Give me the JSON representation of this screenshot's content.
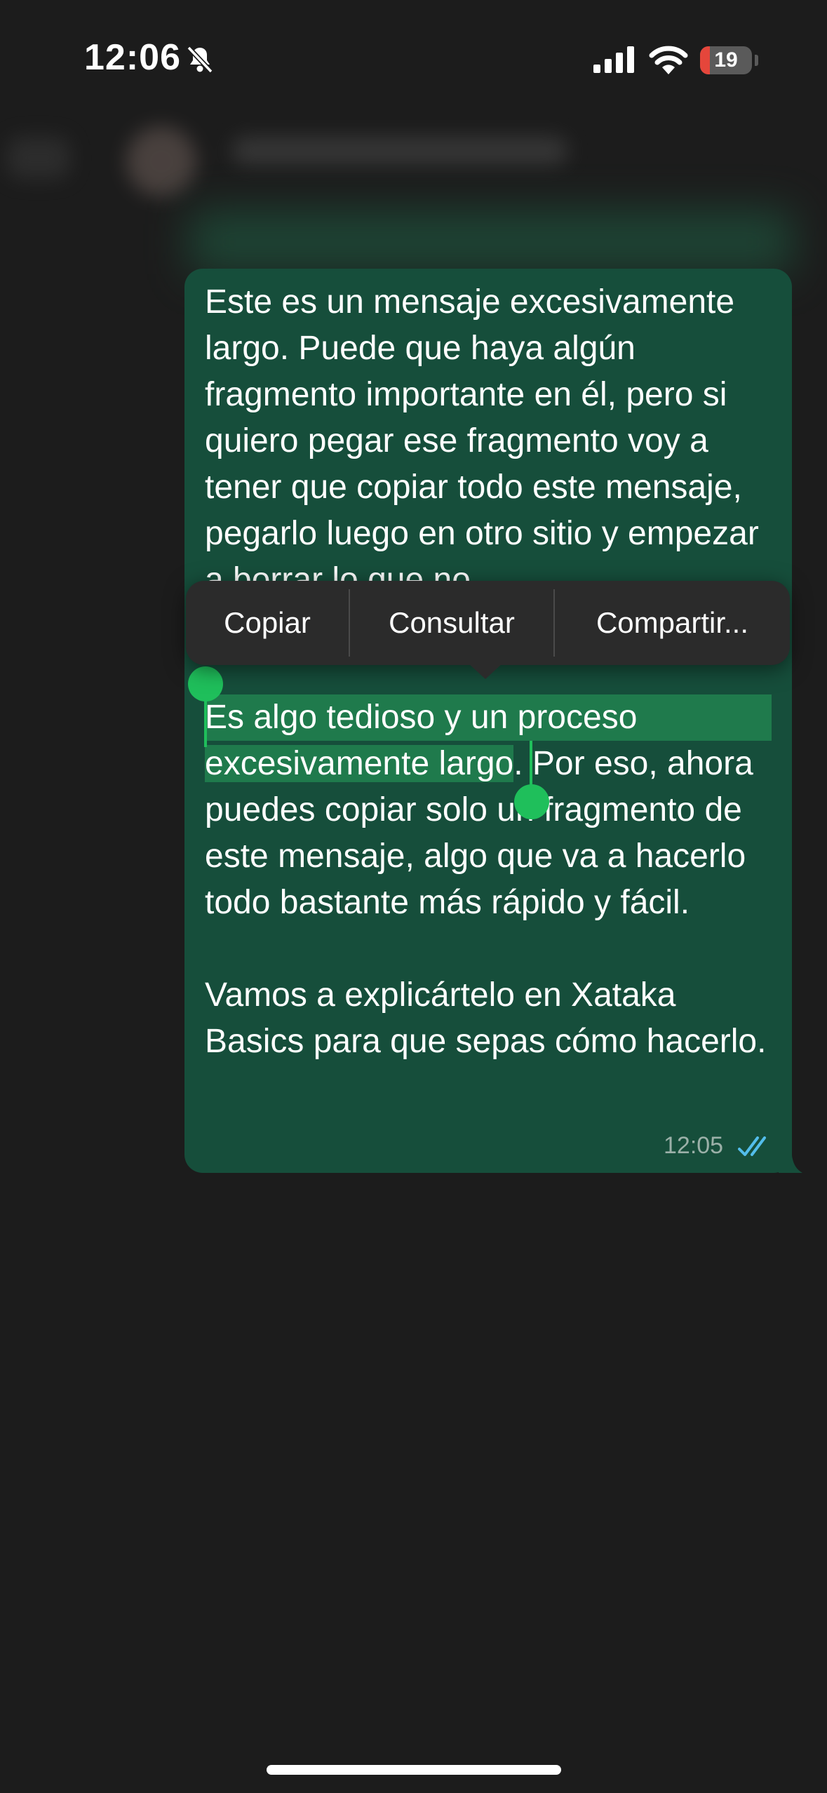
{
  "status_bar": {
    "time": "12:06",
    "battery_level": "19",
    "battery_fraction": 0.19,
    "icons": [
      "bell-slash-icon",
      "cellular-signal-icon",
      "wifi-icon",
      "battery-icon"
    ]
  },
  "message": {
    "text_top": "Este es un mensaje excesivamente largo. Puede que haya algún fragmento importante en él, pero si quiero pegar ese fragmento voy a tener que copiar todo este mensaje, pegarlo luego en otro sitio y empezar a borrar lo que no",
    "selected_text": "Es algo tedioso y un proceso excesivamente largo",
    "after_selection": ". Por eso, ahora puedes copiar solo un fragmento de este mensaje, algo que va a hacerlo todo bastante más rápido y fácil.",
    "paragraph_2": "Vamos a explicártelo en Xataka Basics para que sepas cómo hacerlo.",
    "time": "12:05",
    "status_icon": "double-check-icon"
  },
  "context_menu": {
    "items": [
      "Copiar",
      "Consultar",
      "Compartir..."
    ]
  },
  "colors": {
    "background": "#1c1c1c",
    "bubble": "#164e3b",
    "selection": "#1f7a4c",
    "handle": "#1fbf5b",
    "read_ticks": "#53bdeb",
    "battery_low": "#e5463b"
  }
}
